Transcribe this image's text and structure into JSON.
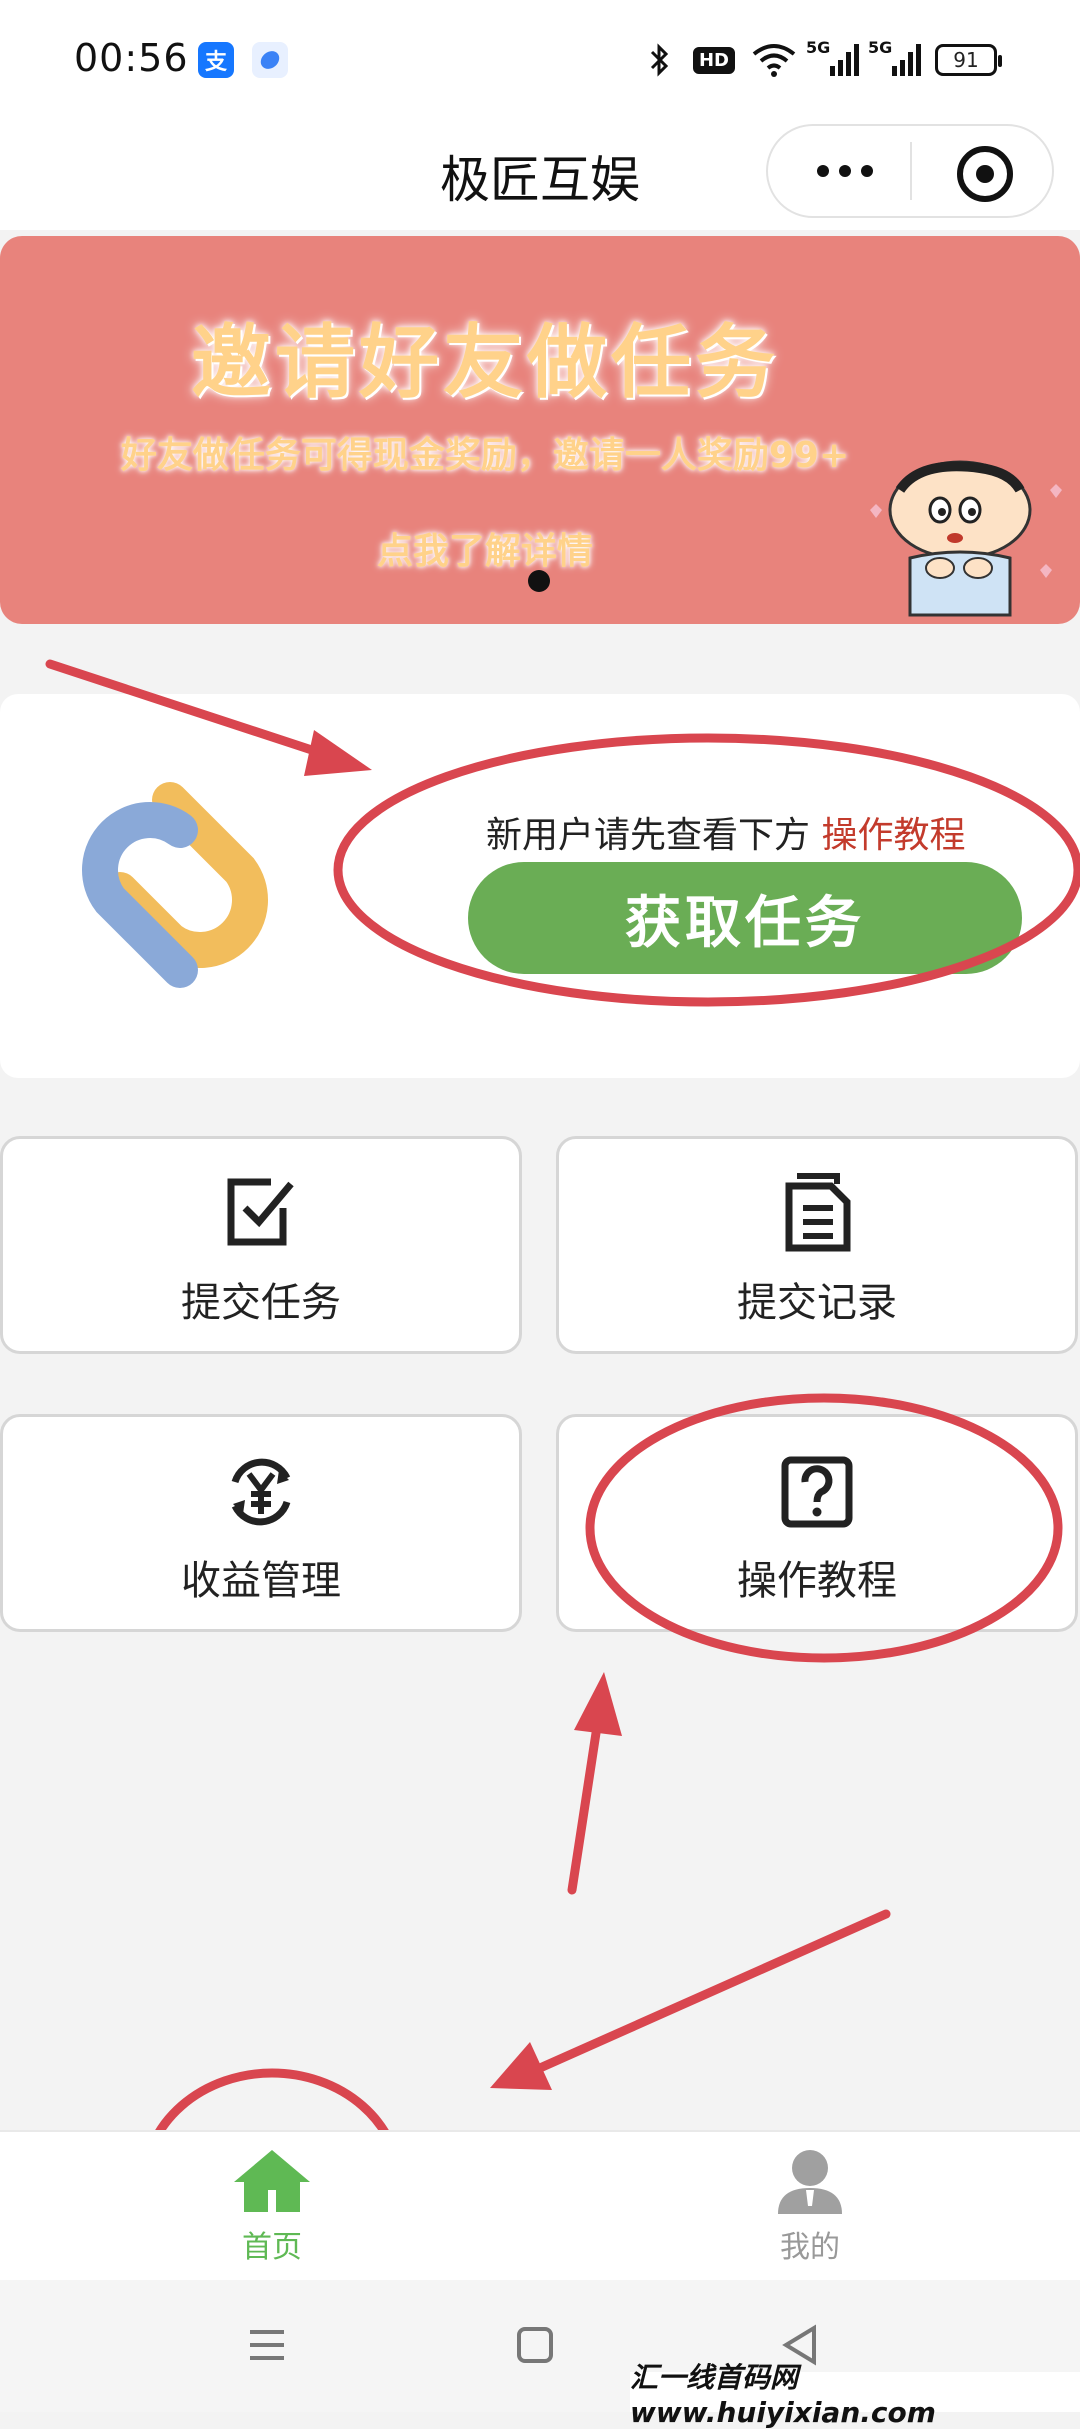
{
  "status_bar": {
    "time": "00:56",
    "app_badge_1": "支",
    "hd_label": "HD",
    "net_1": "5G",
    "net_2": "5G",
    "battery": "91"
  },
  "nav": {
    "title": "极匠互娱"
  },
  "banner": {
    "title": "邀请好友做任务",
    "subtitle": "好友做任务可得现金奖励，邀请一人奖励99+",
    "link": "点我了解详情"
  },
  "task_card": {
    "hint": "新用户请先查看下方",
    "hint_link": "操作教程",
    "button": "获取任务"
  },
  "grid": {
    "submit_task": "提交任务",
    "submit_record": "提交记录",
    "earnings": "收益管理",
    "tutorial": "操作教程"
  },
  "tabbar": {
    "home": "首页",
    "mine": "我的"
  },
  "watermark": "汇一线首码网 www.huiyixian.com",
  "colors": {
    "banner": "#e8837c",
    "primary_green": "#6aad55",
    "link_red": "#c33b2c",
    "annotation_red": "#d9464f"
  }
}
